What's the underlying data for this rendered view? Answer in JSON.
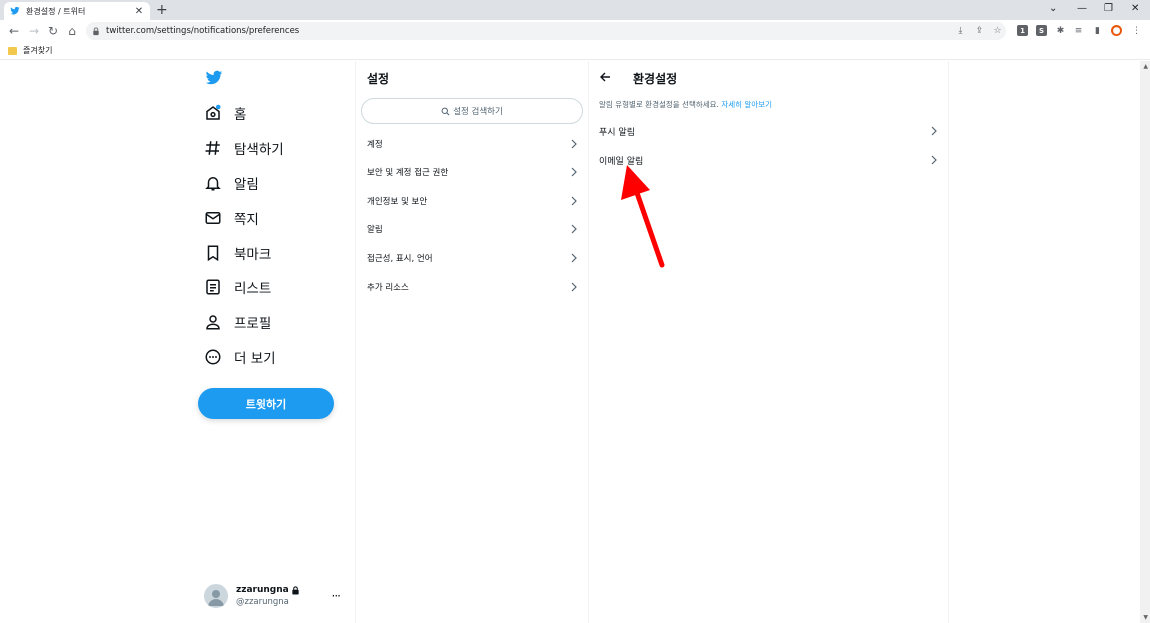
{
  "browser": {
    "tab_title": "환경설정 / 트위터",
    "url": "twitter.com/settings/notifications/preferences",
    "bookmark_folder": "즐겨찾기"
  },
  "nav": {
    "items": [
      {
        "label": "홈",
        "icon": "home-icon"
      },
      {
        "label": "탐색하기",
        "icon": "hashtag-icon"
      },
      {
        "label": "알림",
        "icon": "bell-icon"
      },
      {
        "label": "쪽지",
        "icon": "mail-icon"
      },
      {
        "label": "북마크",
        "icon": "bookmark-icon"
      },
      {
        "label": "리스트",
        "icon": "list-icon"
      },
      {
        "label": "프로필",
        "icon": "person-icon"
      },
      {
        "label": "더 보기",
        "icon": "more-circle-icon"
      }
    ],
    "tweet_button": "트윗하기"
  },
  "account": {
    "name": "zzarungna",
    "handle": "@zzarungna",
    "more": "···"
  },
  "settings": {
    "title": "설정",
    "search_placeholder": "설정 검색하기",
    "items": [
      {
        "label": "계정"
      },
      {
        "label": "보안 및 계정 접근 권한"
      },
      {
        "label": "개인정보 및 보안"
      },
      {
        "label": "알림"
      },
      {
        "label": "접근성, 표시, 언어"
      },
      {
        "label": "추가 리소스"
      }
    ]
  },
  "preferences": {
    "title": "환경설정",
    "description": "알림 유형별로 환경설정을 선택하세요. ",
    "learn_more": "자세히 알아보기",
    "items": [
      {
        "label": "푸시 알림"
      },
      {
        "label": "이메일 알림"
      }
    ]
  },
  "colors": {
    "accent": "#1d9bf0",
    "annotation_arrow": "#ff0000"
  }
}
